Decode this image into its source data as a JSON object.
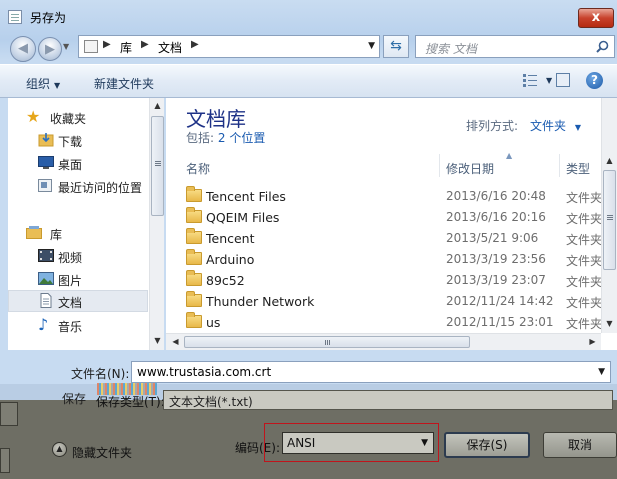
{
  "window": {
    "title": "另存为",
    "close_glyph": "x"
  },
  "address": {
    "crumbs": [
      "库",
      "文档"
    ]
  },
  "search": {
    "placeholder": "搜索 文档"
  },
  "toolbar": {
    "organize": "组织",
    "new_folder": "新建文件夹",
    "help": "?"
  },
  "navigation": {
    "items": [
      {
        "label": "收藏夹",
        "icon": "star-icon"
      },
      {
        "label": "下载",
        "icon": "downloads-icon"
      },
      {
        "label": "桌面",
        "icon": "desktop-icon"
      },
      {
        "label": "最近访问的位置",
        "icon": "recent-places-icon"
      },
      {
        "label": "库",
        "icon": "library-icon"
      },
      {
        "label": "视频",
        "icon": "video-icon"
      },
      {
        "label": "图片",
        "icon": "pictures-icon"
      },
      {
        "label": "文档",
        "icon": "document-icon",
        "selected": true
      },
      {
        "label": "音乐",
        "icon": "music-icon"
      }
    ]
  },
  "library": {
    "title": "文档库",
    "includes_prefix": "包括:",
    "includes_link": "2 个位置",
    "arrange_label": "排列方式:",
    "arrange_value": "文件夹"
  },
  "columns": {
    "name": "名称",
    "modified": "修改日期",
    "type": "类型"
  },
  "files": [
    {
      "name": "Tencent Files",
      "modified": "2013/6/16 20:48",
      "type": "文件夹"
    },
    {
      "name": "QQEIM Files",
      "modified": "2013/6/16 20:16",
      "type": "文件夹"
    },
    {
      "name": "Tencent",
      "modified": "2013/5/21 9:06",
      "type": "文件夹"
    },
    {
      "name": "Arduino",
      "modified": "2013/3/19 23:56",
      "type": "文件夹"
    },
    {
      "name": "89c52",
      "modified": "2013/3/19 23:07",
      "type": "文件夹"
    },
    {
      "name": "Thunder Network",
      "modified": "2012/11/24 14:42",
      "type": "文件夹"
    },
    {
      "name": "us",
      "modified": "2012/11/15 23:01",
      "type": "文件夹"
    }
  ],
  "filename": {
    "label": "文件名(N):",
    "value": "www.trustasia.com.crt"
  },
  "save_type": {
    "label": "保存类型(T):",
    "value": "文本文档(*.txt)",
    "partial_label": "保存"
  },
  "footer": {
    "hide_folders": "隐藏文件夹",
    "encoding_label": "编码(E):",
    "encoding_value": "ANSI",
    "save": "保存(S)",
    "cancel": "取消"
  },
  "colors": {
    "highlight_box": "#c0141c",
    "title_text": "#1e3287",
    "link": "#1a5bb0"
  }
}
